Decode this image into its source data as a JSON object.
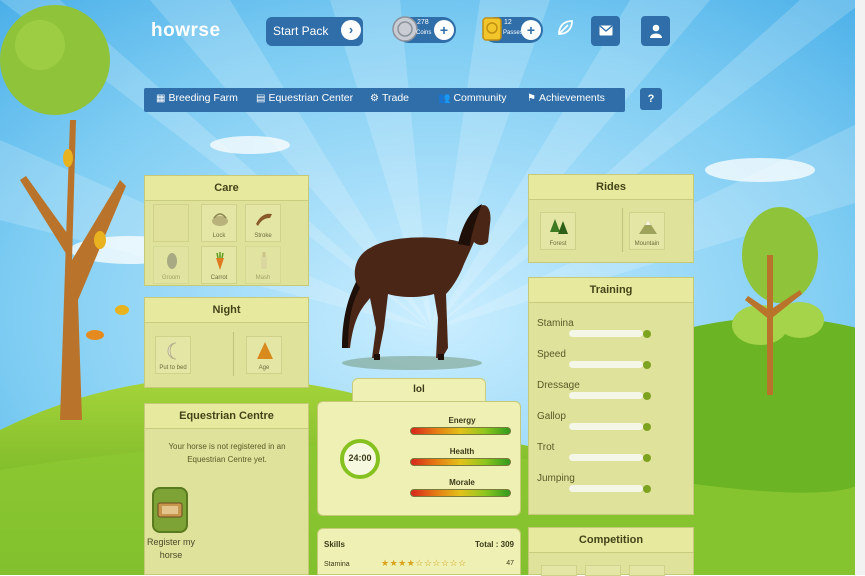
{
  "header": {
    "logo": "howrse",
    "start_pack_label": "Start Pack",
    "start_pack_arrow": "›",
    "coins": {
      "count": "278",
      "name": "Coins",
      "plus": "+"
    },
    "passes": {
      "count": "12",
      "name": "Passes",
      "plus": "+"
    },
    "icons": [
      "leaf-icon",
      "mail-icon",
      "user-icon"
    ]
  },
  "nav": {
    "items": [
      {
        "label": "Breeding Farm",
        "icon": "▦"
      },
      {
        "label": "Equestrian Center",
        "icon": "▤"
      },
      {
        "label": "Trade",
        "icon": "⚙"
      },
      {
        "label": "Community",
        "icon": "👥"
      },
      {
        "label": "Achievements",
        "icon": "⚑"
      }
    ],
    "help": "?"
  },
  "care": {
    "title": "Care",
    "items": [
      {
        "label": "Lock",
        "dim": false
      },
      {
        "label": "Stroke",
        "dim": false
      },
      {
        "label": "Groom",
        "dim": true
      },
      {
        "label": "Carrot",
        "dim": false
      },
      {
        "label": "Mash",
        "dim": true
      }
    ]
  },
  "night": {
    "title": "Night",
    "items": [
      {
        "label": "Put to bed"
      },
      {
        "label": "Age"
      }
    ]
  },
  "equestrian": {
    "title": "Equestrian Centre",
    "message": "Your horse is not registered in an Equestrian Centre yet.",
    "register_label": "Register my horse"
  },
  "horse": {
    "name": "lol",
    "timer": "24:00",
    "stats": [
      {
        "label": "Energy",
        "value": 1.0
      },
      {
        "label": "Health",
        "value": 1.0
      },
      {
        "label": "Morale",
        "value": 1.0
      }
    ]
  },
  "skills": {
    "title": "Skills",
    "total_label": "Total : 309",
    "rows": [
      {
        "name": "Stamina",
        "stars": "★★★★☆☆☆☆☆☆",
        "value": "47"
      }
    ]
  },
  "rides": {
    "title": "Rides",
    "items": [
      {
        "label": "Forest"
      },
      {
        "label": "Mountain"
      }
    ]
  },
  "training": {
    "title": "Training",
    "items": [
      {
        "label": "Stamina",
        "value": 1.0
      },
      {
        "label": "Speed",
        "value": 1.0
      },
      {
        "label": "Dressage",
        "value": 1.0
      },
      {
        "label": "Gallop",
        "value": 1.0
      },
      {
        "label": "Trot",
        "value": 1.0
      },
      {
        "label": "Jumping",
        "value": 1.0
      }
    ]
  },
  "competition": {
    "title": "Competition"
  },
  "colors": {
    "accent": "#2f6ea8",
    "panel": "#dfe29a",
    "progress": "#7ea321"
  }
}
